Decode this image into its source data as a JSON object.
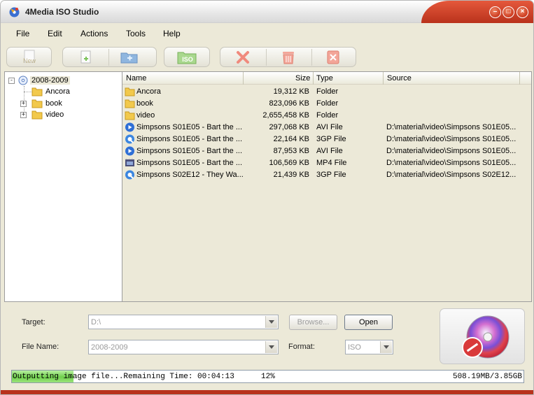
{
  "window": {
    "title": "4Media ISO Studio",
    "accent_color": "#c33a1f",
    "buttons": {
      "minimize": "–",
      "maximize": "□",
      "close": "×"
    }
  },
  "menu": [
    {
      "label": "File"
    },
    {
      "label": "Edit"
    },
    {
      "label": "Actions"
    },
    {
      "label": "Tools"
    },
    {
      "label": "Help"
    }
  ],
  "toolbar": {
    "new_label": "New",
    "add_file_icon": "add-file-icon",
    "add_folder_icon": "add-folder-icon",
    "iso_label": "ISO",
    "delete_icon": "delete-icon",
    "trash_icon": "trash-icon",
    "clear_icon": "clear-all-icon"
  },
  "tree": {
    "root": "2008-2009",
    "expander_collapse": "-",
    "expander_expand": "+",
    "children": [
      {
        "label": "Ancora",
        "expandable": false
      },
      {
        "label": "book",
        "expandable": true
      },
      {
        "label": "video",
        "expandable": true
      }
    ]
  },
  "list": {
    "columns": {
      "name": "Name",
      "size": "Size",
      "type": "Type",
      "source": "Source"
    },
    "rows": [
      {
        "icon": "folder",
        "name": "Ancora",
        "size": "19,312 KB",
        "type": "Folder",
        "source": ""
      },
      {
        "icon": "folder",
        "name": "book",
        "size": "823,096 KB",
        "type": "Folder",
        "source": ""
      },
      {
        "icon": "folder",
        "name": "video",
        "size": "2,655,458 KB",
        "type": "Folder",
        "source": ""
      },
      {
        "icon": "avi",
        "name": "Simpsons S01E05 - Bart the ...",
        "size": "297,068 KB",
        "type": "AVI File",
        "source": "D:\\material\\video\\Simpsons S01E05..."
      },
      {
        "icon": "3gp",
        "name": "Simpsons S01E05 - Bart the ...",
        "size": "22,164 KB",
        "type": "3GP File",
        "source": "D:\\material\\video\\Simpsons S01E05..."
      },
      {
        "icon": "avi",
        "name": "Simpsons S01E05 - Bart the ...",
        "size": "87,953 KB",
        "type": "AVI File",
        "source": "D:\\material\\video\\Simpsons S01E05..."
      },
      {
        "icon": "mp4",
        "name": "Simpsons S01E05 - Bart the ...",
        "size": "106,569 KB",
        "type": "MP4 File",
        "source": "D:\\material\\video\\Simpsons S01E05..."
      },
      {
        "icon": "3gp",
        "name": "Simpsons S02E12 - They Wa...",
        "size": "21,439 KB",
        "type": "3GP File",
        "source": "D:\\material\\video\\Simpsons S02E12..."
      }
    ]
  },
  "output": {
    "target_label": "Target:",
    "target_value": "D:\\",
    "browse_label": "Browse...",
    "open_label": "Open",
    "filename_label": "File Name:",
    "filename_value": "2008-2009",
    "format_label": "Format:",
    "format_value": "ISO"
  },
  "status": {
    "message": "Outputting image file...Remaining Time: 00:04:13",
    "percent_text": "12%",
    "progress": 0.12,
    "size_text": "508.19MB/3.85GB"
  }
}
